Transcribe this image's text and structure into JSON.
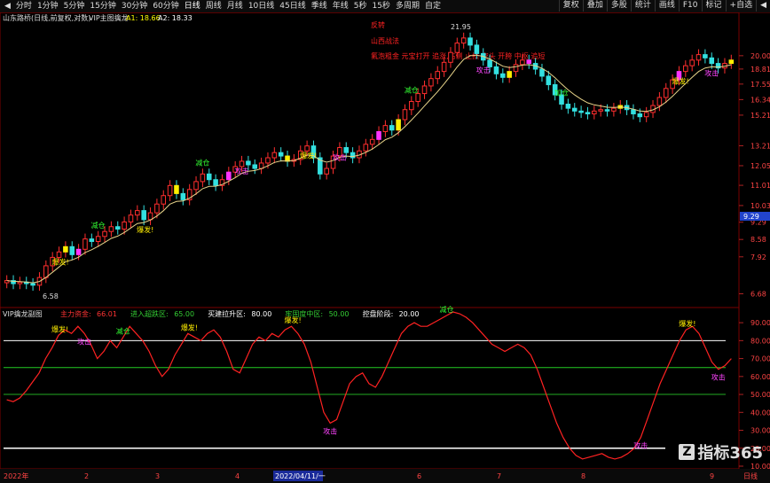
{
  "toolbar": {
    "periods": [
      "分时",
      "1分钟",
      "5分钟",
      "15分钟",
      "30分钟",
      "60分钟",
      "日线",
      "周线",
      "月线",
      "10日线",
      "45日线",
      "季线",
      "年线",
      "5秒",
      "15秒",
      "多周期",
      "自定"
    ],
    "active_period": "日线",
    "left_glyph": "◀",
    "right_buttons": [
      "复权",
      "叠加",
      "多股",
      "统计",
      "画线",
      "F10",
      "标记",
      "+自选",
      "◀"
    ]
  },
  "main_panel": {
    "title": "山东路桥(日线,前复权,对数)",
    "indicator": "VIP主图擒龙",
    "a1": "A1: 18.66",
    "a2": "A2: 18.33",
    "legend": [
      "反转",
      "山西战法",
      "氟泡粗金 元宝打开 追涨,右侧 止损 空头 开胯 中枢 追短"
    ],
    "price_ticks": [
      "20.00",
      "18.81",
      "17.55",
      "16.34",
      "15.21",
      "13.21",
      "12.05",
      "11.01",
      "10.03",
      "9.29",
      "8.58",
      "7.92",
      "6.68"
    ],
    "current_price": "9.29",
    "high_label": "21.95",
    "low_label": "6.58"
  },
  "sub_panel": {
    "title": "VIP擒龙副图",
    "items": [
      {
        "label": "主力资金:",
        "value": "66.01",
        "color": "#ff3333"
      },
      {
        "label": "进入超跌区:",
        "value": "65.00",
        "color": "#33cc33"
      },
      {
        "label": "买建拉升区:",
        "value": "80.00",
        "color": "#ffffff"
      },
      {
        "label": "牢固度中区:",
        "value": "50.00",
        "color": "#33cc33"
      },
      {
        "label": "控盘阶段:",
        "value": "20.00",
        "color": "#ffffff"
      }
    ],
    "axis_ticks": [
      "90.00",
      "80.00",
      "70.00",
      "60.00",
      "50.00",
      "40.00",
      "30.00",
      "20.00",
      "10.00"
    ]
  },
  "bottom_axis": {
    "labels": [
      "2022年",
      "2",
      "3",
      "4",
      "2022/04/11/一",
      "6",
      "7",
      "8",
      "9",
      "日线"
    ]
  },
  "signals": {
    "baofa": "爆发!",
    "xiluo": "减仓",
    "jiacang": "加仓",
    "gongji": "攻击"
  },
  "logo": "指标365",
  "chart_data": {
    "type": "line",
    "main_series_close": [
      7.1,
      7.0,
      7.05,
      7.0,
      6.95,
      7.2,
      7.6,
      7.9,
      8.1,
      8.3,
      8.0,
      8.2,
      8.6,
      8.5,
      8.7,
      8.9,
      9.1,
      9.0,
      9.3,
      9.6,
      9.8,
      9.4,
      9.7,
      10.1,
      10.5,
      11.0,
      10.6,
      10.3,
      10.8,
      11.2,
      11.6,
      11.3,
      11.0,
      11.3,
      11.7,
      12.0,
      12.3,
      12.1,
      11.9,
      12.2,
      12.5,
      12.8,
      12.6,
      12.3,
      12.4,
      12.9,
      13.2,
      12.5,
      11.6,
      11.9,
      12.6,
      13.1,
      12.8,
      12.5,
      12.9,
      13.3,
      13.6,
      14.1,
      14.5,
      14.2,
      14.9,
      15.6,
      16.2,
      16.8,
      17.4,
      18.0,
      18.6,
      19.4,
      20.3,
      21.2,
      21.7,
      21.0,
      20.2,
      19.6,
      19.0,
      18.4,
      18.1,
      18.6,
      19.2,
      19.6,
      19.3,
      18.8,
      18.2,
      17.5,
      16.7,
      16.0,
      15.7,
      15.5,
      15.4,
      15.3,
      15.5,
      15.6,
      15.5,
      15.7,
      15.9,
      15.6,
      15.3,
      15.1,
      15.4,
      15.9,
      16.5,
      17.2,
      17.9,
      18.6,
      19.1,
      19.6,
      20.1,
      19.8,
      19.3,
      18.9,
      19.3,
      19.6
    ],
    "sub_series": [
      47,
      46,
      48,
      52,
      57,
      62,
      70,
      76,
      83,
      86,
      84,
      88,
      84,
      78,
      70,
      74,
      80,
      76,
      82,
      88,
      84,
      80,
      74,
      66,
      60,
      64,
      72,
      78,
      84,
      82,
      80,
      84,
      86,
      82,
      74,
      64,
      62,
      70,
      78,
      82,
      80,
      84,
      82,
      86,
      88,
      84,
      78,
      68,
      54,
      40,
      34,
      36,
      46,
      56,
      60,
      62,
      56,
      54,
      60,
      68,
      76,
      84,
      88,
      90,
      88,
      88,
      90,
      92,
      94,
      96,
      95,
      93,
      90,
      86,
      82,
      78,
      76,
      74,
      76,
      78,
      76,
      72,
      64,
      54,
      44,
      34,
      26,
      20,
      16,
      14,
      15,
      16,
      17,
      15,
      14,
      15,
      17,
      20,
      26,
      36,
      46,
      56,
      64,
      72,
      80,
      86,
      88,
      84,
      76,
      68,
      64,
      66,
      70
    ],
    "sub_ylim": [
      10,
      95
    ],
    "levels": {
      "买建拉升区": 80,
      "进入超跌区": 65,
      "牢固度中区": 50,
      "控盘阶段": 20
    }
  }
}
